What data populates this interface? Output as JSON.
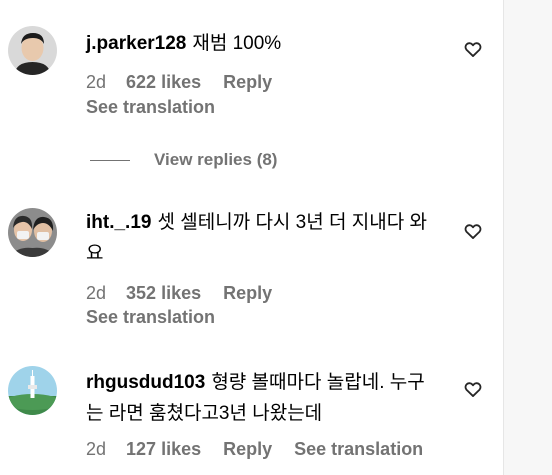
{
  "comments": [
    {
      "username": "j.parker128",
      "text": "재범 100%",
      "time": "2d",
      "likes": "622 likes",
      "reply": "Reply",
      "translation": "See translation",
      "avatar": "avatar-man-icon"
    },
    {
      "username": "iht._.19",
      "text": "셋 셀테니까 다시 3년 더 지내다 와요",
      "time": "2d",
      "likes": "352 likes",
      "reply": "Reply",
      "translation": "See translation",
      "avatar": "avatar-two-people-icon"
    },
    {
      "username": "rhgusdud103",
      "text": "형량 볼때마다 놀랍네. 누구는 라면 훔쳤다고3년 나왔는데",
      "time": "2d",
      "likes": "127 likes",
      "reply": "Reply",
      "translation": "See translation",
      "avatar": "avatar-tower-icon"
    }
  ],
  "view_replies": "View replies (8)",
  "colors": {
    "muted": "#737373",
    "text": "#000000",
    "background": "#ffffff"
  }
}
